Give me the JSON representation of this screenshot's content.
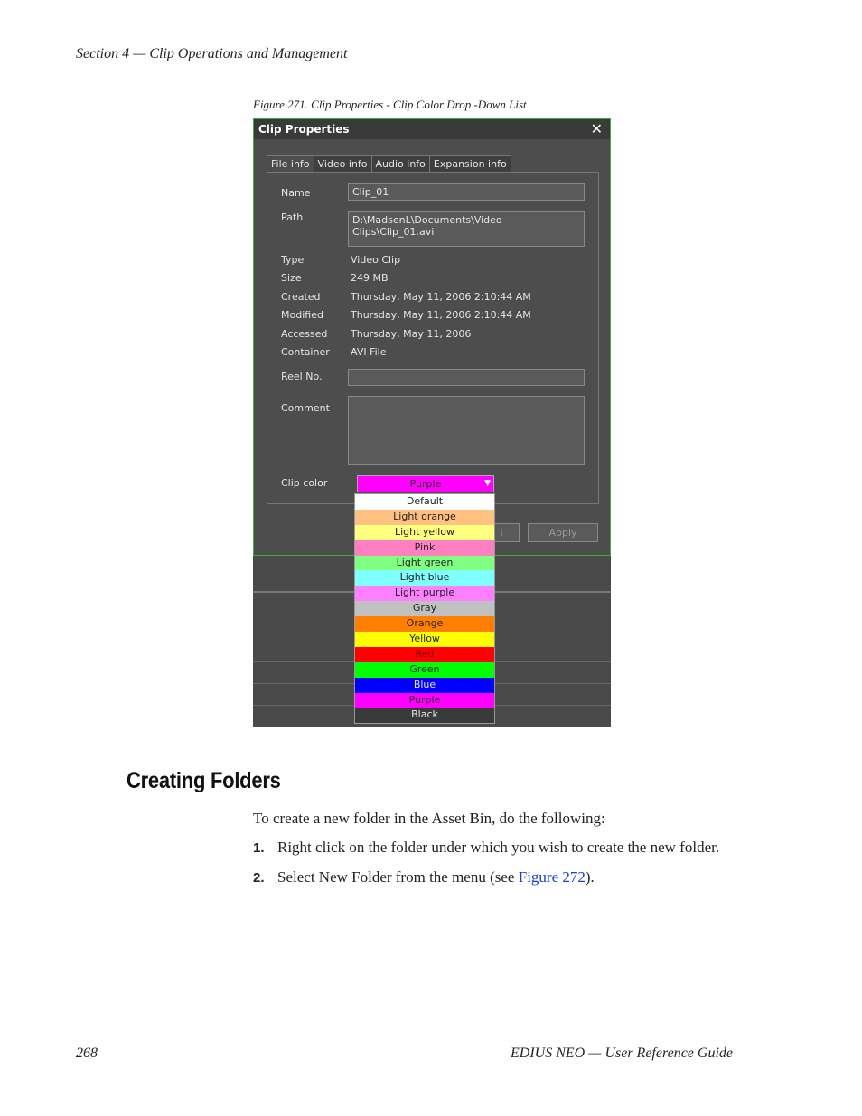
{
  "page": {
    "header": "Section 4 — Clip Operations and Management",
    "caption": "Figure 271.  Clip Properties - Clip Color Drop -Down List",
    "footer_page": "268",
    "footer_title": "EDIUS NEO  —  User Reference Guide"
  },
  "dialog": {
    "title": "Clip Properties",
    "close": "✕",
    "tabs": [
      "File info",
      "Video info",
      "Audio info",
      "Expansion info"
    ],
    "fields": {
      "name_label": "Name",
      "name_value": "Clip_01",
      "path_label": "Path",
      "path_value": "D:\\MadsenL\\Documents\\Video Clips\\Clip_01.avi",
      "type_label": "Type",
      "type_value": "Video Clip",
      "size_label": "Size",
      "size_value": "249 MB",
      "created_label": "Created",
      "created_value": "Thursday, May 11, 2006 2:10:44 AM",
      "modified_label": "Modified",
      "modified_value": "Thursday, May 11, 2006 2:10:44 AM",
      "accessed_label": "Accessed",
      "accessed_value": "Thursday, May 11, 2006",
      "container_label": "Container",
      "container_value": "AVI File",
      "reel_label": "Reel No.",
      "reel_value": "",
      "comment_label": "Comment",
      "comment_value": "",
      "clipcolor_label": "Clip color",
      "clipcolor_value": "Purple"
    },
    "buttons": {
      "cancel_partial": "l",
      "apply": "Apply"
    },
    "color_options": [
      {
        "label": "Default",
        "color": "#ffffff"
      },
      {
        "label": "Light orange",
        "color": "#ffc080"
      },
      {
        "label": "Light yellow",
        "color": "#ffff80"
      },
      {
        "label": "Pink",
        "color": "#ff80c0"
      },
      {
        "label": "Light green",
        "color": "#80ff80"
      },
      {
        "label": "Light blue",
        "color": "#80ffff"
      },
      {
        "label": "Light purple",
        "color": "#ff80ff"
      },
      {
        "label": "Gray",
        "color": "#c0c0c0"
      },
      {
        "label": "Orange",
        "color": "#ff8000"
      },
      {
        "label": "Yellow",
        "color": "#ffff00"
      },
      {
        "label": "Red",
        "color": "#ff0000"
      },
      {
        "label": "Green",
        "color": "#00ff00"
      },
      {
        "label": "Blue",
        "color": "#0000ff"
      },
      {
        "label": "Purple",
        "color": "#ff00ff"
      },
      {
        "label": "Black",
        "color": "#3a3a3a"
      }
    ]
  },
  "section": {
    "heading": "Creating Folders",
    "intro": "To create a new folder in the Asset Bin, do the following:",
    "step1_num": "1.",
    "step1_text": "Right click on the folder under which you wish to create the new folder.",
    "step2_num": "2.",
    "step2_text_before": "Select New Folder from the menu (see ",
    "step2_link": "Figure 272",
    "step2_text_after": ")."
  }
}
